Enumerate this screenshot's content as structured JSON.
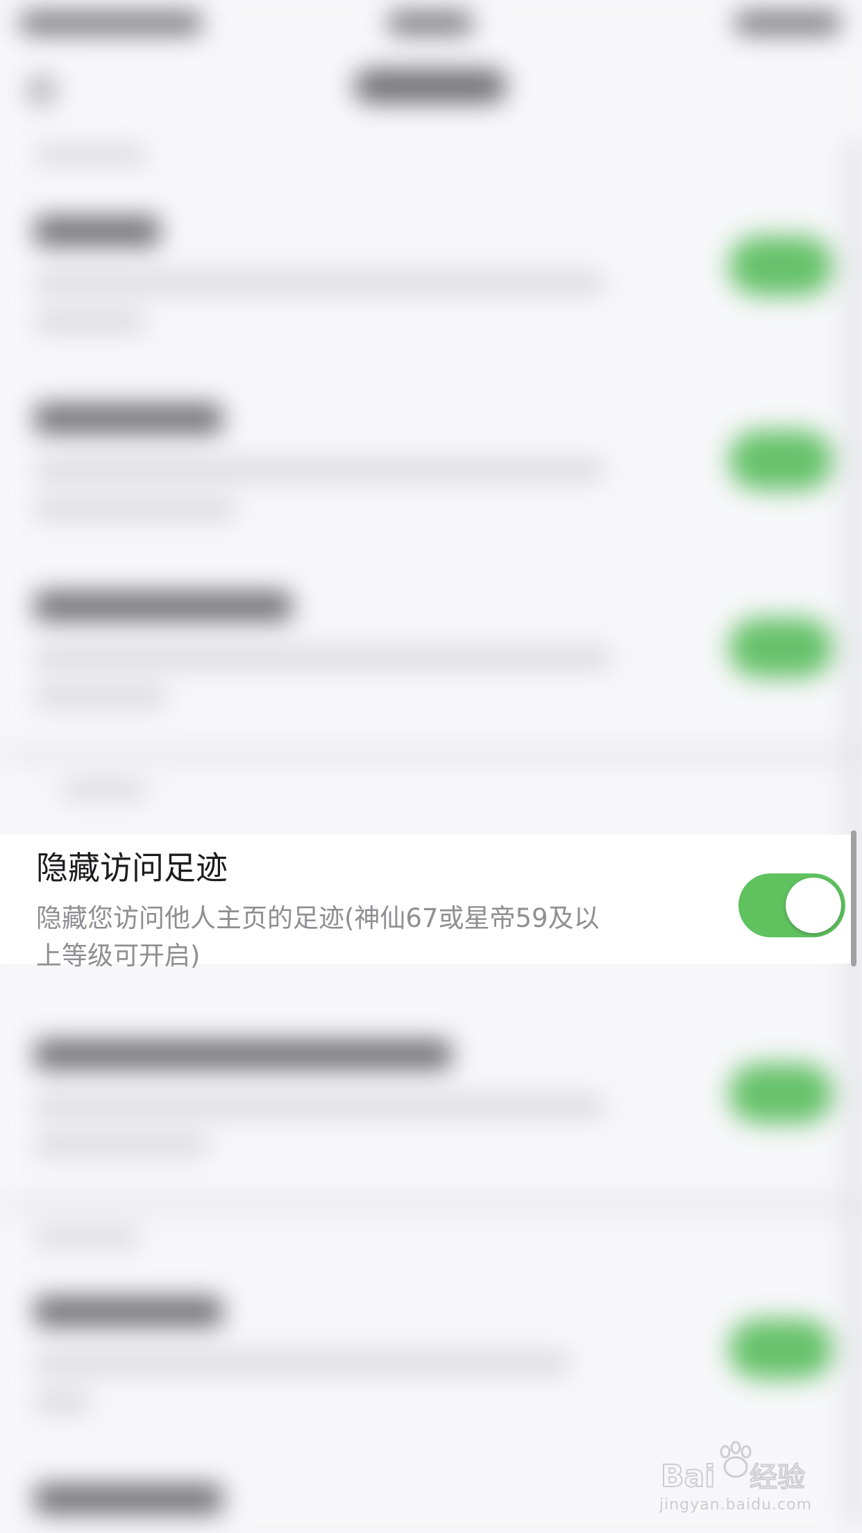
{
  "focused_setting": {
    "title": "隐藏访问足迹",
    "description": "隐藏您访问他人主页的足迹(神仙67或星帝59及以上等级可开启)",
    "toggle_on": true
  },
  "colors": {
    "toggle_on": "#5fc25f",
    "title_text": "#1c1c1e",
    "description_text": "#8e8e93",
    "background": "#f6f6f8"
  },
  "watermark": {
    "brand": "Baidu经验",
    "domain": "jingyan.baidu.com"
  }
}
